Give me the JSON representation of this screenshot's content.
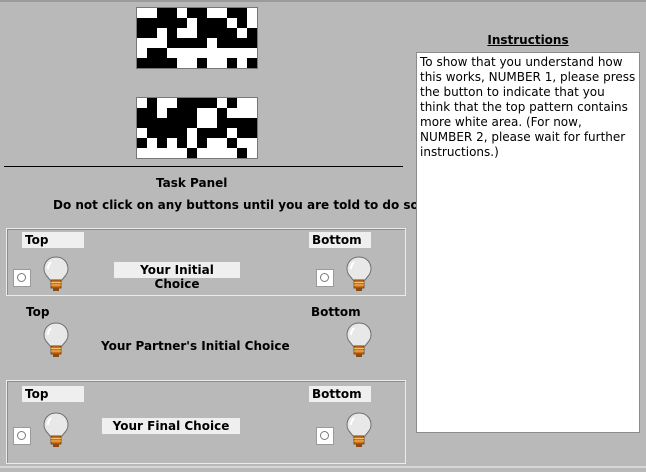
{
  "task_panel": {
    "title": "Task Panel",
    "warning": "Do not click on any buttons until you are told to do so!"
  },
  "initial_choice": {
    "top_label": "Top",
    "bottom_label": "Bottom",
    "center_label": "Your Initial Choice"
  },
  "partner_choice": {
    "top_label": "Top",
    "bottom_label": "Bottom",
    "center_label": "Your Partner's Initial Choice"
  },
  "final_choice": {
    "top_label": "Top",
    "bottom_label": "Bottom",
    "center_label": "Your Final Choice"
  },
  "instructions": {
    "title": "Instructions",
    "text": "To show that you understand how this works, NUMBER 1, please press the button to indicate that you think that the top pattern contains more white area. (For now, NUMBER 2, please wait for further instructions.)"
  },
  "icons": {
    "bulb": "light-bulb-icon",
    "pattern": "checker-pattern"
  },
  "colors": {
    "background": "#b9b9b9",
    "chip": "#efefef",
    "bulb_glass": "#e8e8e8",
    "bulb_base": "#d2701a"
  }
}
